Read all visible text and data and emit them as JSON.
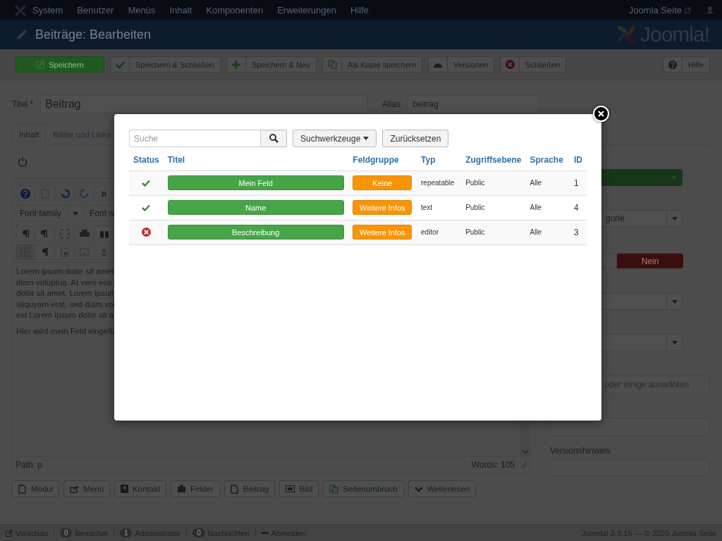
{
  "navbar": {
    "menu": [
      "System",
      "Benutzer",
      "Menüs",
      "Inhalt",
      "Komponenten",
      "Erweiterungen",
      "Hilfe"
    ],
    "site_link": "Joomla Seite"
  },
  "header": {
    "title": "Beiträge: Bearbeiten",
    "logo_text": "Joomla!"
  },
  "toolbar": {
    "buttons": [
      {
        "label": "Speichern",
        "kind": "primary"
      },
      {
        "label": "Speichern & Schließen",
        "kind": "default"
      },
      {
        "label": "Speichern & Neu",
        "kind": "default"
      },
      {
        "label": "Als Kopie speichern",
        "kind": "default"
      },
      {
        "label": "Versionen",
        "kind": "default"
      },
      {
        "label": "Schließen",
        "kind": "default"
      }
    ],
    "help": "Hilfe"
  },
  "title_field": {
    "label": "Titel *",
    "value": "Beitrag"
  },
  "alias_field": {
    "label": "Alias",
    "value": "beitrag"
  },
  "tabs": [
    {
      "label": "Inhalt",
      "selected": true
    },
    {
      "label": "Bilder und Links",
      "selected": false
    }
  ],
  "editor": {
    "bold_label": "B",
    "font_family": "Font family",
    "font_size": "Font si",
    "lines": [
      "Lorem ipsum dolor sit amet,",
      "diam voluptua. At vero eos",
      "dolor sit amet. Lorem ipsum",
      "aliquyam erat, sed diam vol",
      "est Lorem ipsum dolor sit a"
    ],
    "paragraph": "Hier wird mein Feld eingefü",
    "path": "Path: p",
    "words": "Words: 105"
  },
  "editor_buttons": [
    "Modul",
    "Menü",
    "Kontakt",
    "Felder",
    "Beitrag",
    "Bild",
    "Seitenumbruch",
    "Weiterlesen"
  ],
  "sidebar": {
    "category": "gorie",
    "featured": [
      {
        "label": "Nein",
        "selected": true
      }
    ],
    "tags_placeholder": "oder einige auswählen",
    "version_note_label": "Versionshinweis"
  },
  "status_bar": {
    "items": [
      {
        "label": "Vorschau"
      },
      {
        "count": "0",
        "label": "Besucher"
      },
      {
        "count": "1",
        "label": "Administrator"
      },
      {
        "count": "0",
        "label": "Nachrichten"
      },
      {
        "label": "Abmelden"
      }
    ],
    "copyright": "Joomla! 3.9.15 — © 2020 Joomla Seite"
  },
  "modal": {
    "search_placeholder": "Suche",
    "search_tools": "Suchwerkzeuge",
    "reset": "Zurücksetzen",
    "columns": [
      "Status",
      "Titel",
      "Feldgruppe",
      "Typ",
      "Zugriffsebene",
      "Sprache",
      "ID"
    ],
    "rows": [
      {
        "published": true,
        "title": "Mein Feld",
        "group": "Keine",
        "type": "repeatable",
        "access": "Public",
        "language": "Alle",
        "id": "1"
      },
      {
        "published": true,
        "title": "Name",
        "group": "Weitere Infos",
        "type": "text",
        "access": "Public",
        "language": "Alle",
        "id": "4"
      },
      {
        "published": false,
        "title": "Beschreibung",
        "group": "Weitere Infos",
        "type": "editor",
        "access": "Public",
        "language": "Alle",
        "id": "3"
      }
    ]
  }
}
